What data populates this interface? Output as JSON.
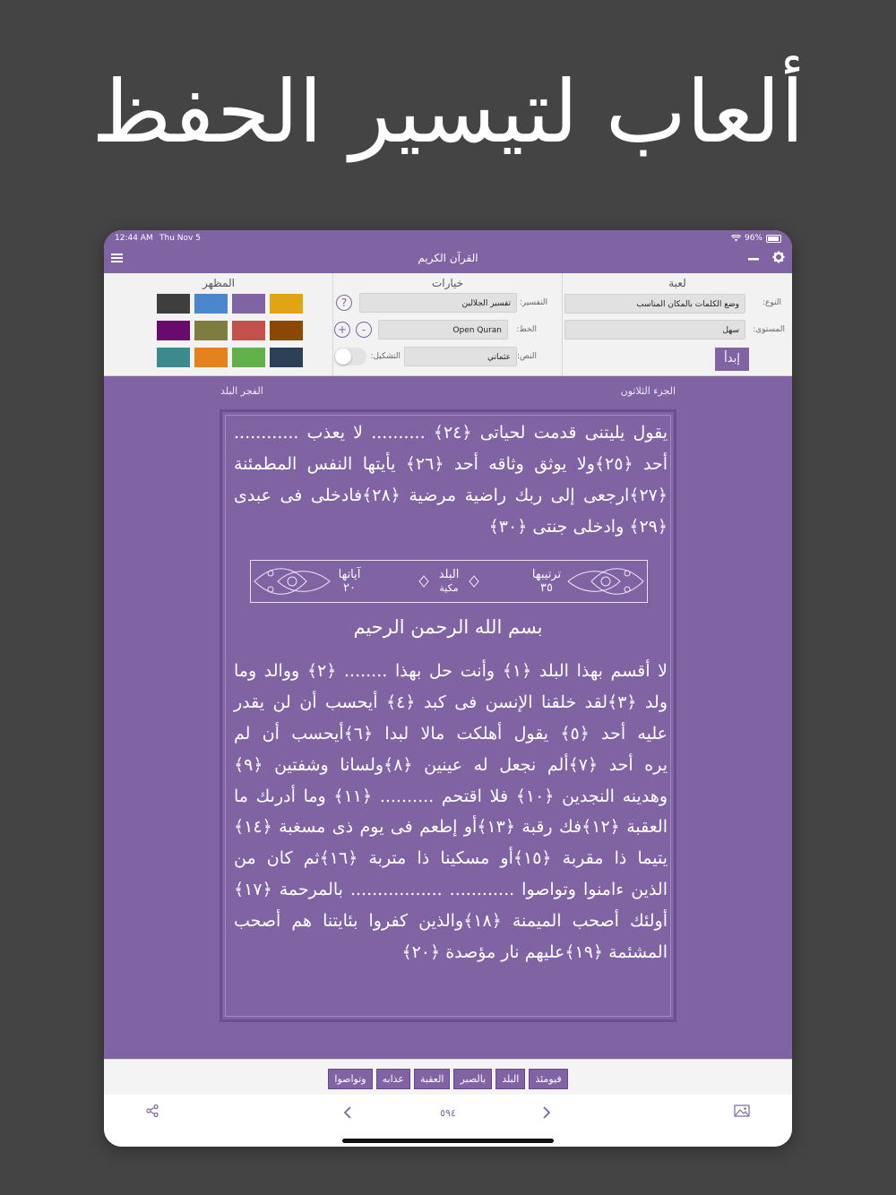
{
  "headline": "ألعاب لتيسير الحفظ",
  "status_bar": {
    "time": "12:44 AM",
    "date": "Thu Nov 5",
    "battery": "96%"
  },
  "nav": {
    "title": "القرآن الكريم"
  },
  "panel": {
    "game": {
      "title": "لعبة",
      "type_label": "النوع:",
      "type_value": "وضع الكلمات بالمكان المناسب",
      "level_label": "المستوى:",
      "level_value": "سهل",
      "start_label": "إبدأ"
    },
    "options": {
      "title": "خيارات",
      "tafsir_label": "التفسير:",
      "tafsir_value": "تفسير الجلالين",
      "help_label": "?",
      "font_label": "الخط:",
      "font_value": "Open Quran",
      "plus_label": "+",
      "minus_label": "-",
      "text_label": "النص:",
      "text_value": "عثماني",
      "tashkeel_label": "التشكيل:"
    },
    "appearance": {
      "title": "المظهر",
      "colors": [
        "#e0a513",
        "#7f63a3",
        "#4a86c8",
        "#3e3e3e",
        "#8c4800",
        "#c4504c",
        "#7d7d3f",
        "#6a0a6e",
        "#2b3f57",
        "#62b04a",
        "#e4821e",
        "#3c8a8b"
      ]
    }
  },
  "page": {
    "juz": "الجزء الثلاثون",
    "surahs": "الفجر  البلد",
    "lines_top": [
      "يقول يليتنى قدمت لحياتى ﴿٢٤﴾ .......... لا يعذب ............",
      "أحد ﴿٢٥﴾ولا يوثق وثاقه أحد ﴿٢٦﴾ يأيتها النفس المطمئنة",
      "﴿٢٧﴾ارجعى إلى ربك راضية مرضية ﴿٢٨﴾فادخلى فى عبدى",
      "﴿٢٩﴾ وادخلى جنتى ﴿٣٠﴾"
    ],
    "surah_header": {
      "order_label": "ترتيبها",
      "order_value": "٣٥",
      "name": "البلد",
      "place": "مكية",
      "ayat_label": "آياتها",
      "ayat_value": "٢٠"
    },
    "basmala": "بسم الله الرحمن الرحيم",
    "lines_bottom": [
      "لا أقسم بهذا البلد ﴿١﴾ وأنت حل بهذا ........ ﴿٢﴾ ووالد وما",
      "ولد ﴿٣﴾لقد خلقنا الإنسن فى كبد ﴿٤﴾ أيحسب أن لن يقدر",
      "عليه أحد ﴿٥﴾ يقول أهلكت مالا لبدا ﴿٦﴾أيحسب أن لم",
      "يره أحد ﴿٧﴾ألم نجعل له عينين ﴿٨﴾ولسانا وشفتين ﴿٩﴾",
      "وهدينه النجدين ﴿١٠﴾ فلا اقتحم .......... ﴿١١﴾ وما أدرىك ما",
      "العقبة ﴿١٢﴾فك رقبة ﴿١٣﴾أو إطعم فى يوم ذى مسغبة ﴿١٤﴾",
      "يتيما ذا مقربة ﴿١٥﴾أو مسكينا ذا متربة ﴿١٦﴾ثم كان من",
      "الذين ءامنوا وتواصوا ............ ................. بالمرحمة ﴿١٧﴾",
      "أولئك أصحب الميمنة ﴿١٨﴾والذين كفروا بئايتنا هم أصحب",
      "المشئمة ﴿١٩﴾عليهم نار مؤصدة ﴿٢٠﴾"
    ]
  },
  "word_chips": [
    "فيومئذ",
    "البلد",
    "بالصبر",
    "العقبة",
    "عذابه",
    "وتواصوا"
  ],
  "toolbar": {
    "page_number": "٥٩٤"
  }
}
